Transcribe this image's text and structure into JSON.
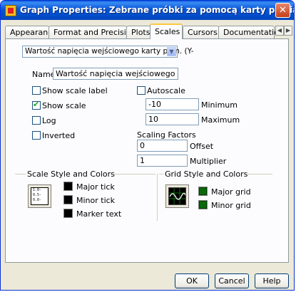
{
  "window": {
    "title": "Graph Properties: Zebrane próbki za pomocą karty pomiarowej",
    "close_label": "✕"
  },
  "tabs": [
    {
      "label": "Appearance"
    },
    {
      "label": "Format and Precision"
    },
    {
      "label": "Plots"
    },
    {
      "label": "Scales",
      "active": true
    },
    {
      "label": "Cursors"
    },
    {
      "label": "Documentation"
    }
  ],
  "tab_scroll": {
    "left": "◀",
    "right": "▶"
  },
  "scale_select": {
    "value": "Wartość napięcia wejściowego karty pom. (Y-",
    "arrow": "▼"
  },
  "name": {
    "label": "Name",
    "value": "Wartość napięcia wejściowego karty pom."
  },
  "options": {
    "show_scale_label": {
      "label": "Show scale label",
      "checked": false
    },
    "show_scale": {
      "label": "Show scale",
      "checked": true
    },
    "log": {
      "label": "Log",
      "checked": false
    },
    "inverted": {
      "label": "Inverted",
      "checked": false
    },
    "autoscale": {
      "label": "Autoscale",
      "checked": false
    }
  },
  "range": {
    "minimum": {
      "value": "-10",
      "label": "Minimum"
    },
    "maximum": {
      "value": "10",
      "label": "Maximum"
    }
  },
  "scaling": {
    "title": "Scaling Factors",
    "offset": {
      "value": "0",
      "label": "Offset"
    },
    "multiplier": {
      "value": "1",
      "label": "Multiplier"
    }
  },
  "scale_style": {
    "title": "Scale Style and Colors",
    "icon_lines": [
      "1.0-",
      "0.5-",
      "0.0-"
    ],
    "major_tick": "Major tick",
    "minor_tick": "Minor tick",
    "marker_text": "Marker text"
  },
  "grid_style": {
    "title": "Grid Style and Colors",
    "major_grid": "Major grid",
    "minor_grid": "Minor grid"
  },
  "buttons": {
    "ok": "OK",
    "cancel": "Cancel",
    "help": "Help"
  },
  "colors": {
    "title_bar": "#0655d4",
    "active_tab_accent": "#ffc83c",
    "check_green": "#21a121",
    "grid_swatch": "#0a6a0a",
    "marker_swatch": "#000000"
  }
}
